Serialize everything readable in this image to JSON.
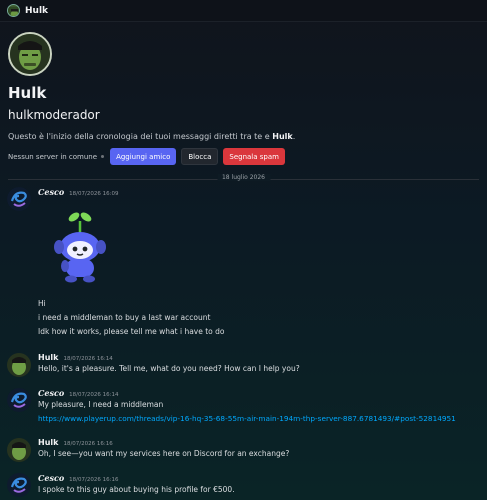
{
  "window": {
    "title": "Hulk"
  },
  "profile": {
    "display_name": "Hulk",
    "username": "hulkmoderador",
    "intro_prefix": "Questo è l'inizio della cronologia dei tuoi messaggi diretti tra te e ",
    "intro_name": "Hulk",
    "intro_suffix": ".",
    "no_server": "Nessun server in comune",
    "add_friend": "Aggiungi amico",
    "block": "Blocca",
    "report_spam": "Segnala spam"
  },
  "date_divider": "18 luglio 2026",
  "messages": [
    {
      "author": "Cesco",
      "time": "18/07/2026 16:09",
      "lines": [
        "Hi",
        "i need a middleman to buy a last war account",
        "Idk how it works, please tell me what i have to do"
      ]
    },
    {
      "author": "Hulk",
      "time": "18/07/2026 16:14",
      "lines": [
        "Hello, it's a pleasure. Tell me, what do you need? How can I help you?"
      ]
    },
    {
      "author": "Cesco",
      "time": "18/07/2026 16:14",
      "lines": [
        "My pleasure, I need a middleman"
      ],
      "link": "https://www.playerup.com/threads/vip-16-hq-35-68-55m-air-main-194m-thp-server-887.6781493/#post-52814951"
    },
    {
      "author": "Hulk",
      "time": "18/07/2026 16:16",
      "lines": [
        "Oh, I see—you want my services here on Discord for an exchange?"
      ]
    },
    {
      "author": "Cesco",
      "time": "18/07/2026 16:16",
      "lines": [
        "I spoke to this guy about buying his profile for €500."
      ]
    }
  ],
  "colors": {
    "accent": "#5865f2",
    "danger": "#da373c",
    "link": "#00a8fc"
  },
  "icons": {
    "hulk_avatar": "hulk-face-icon",
    "cesco_avatar": "swirl-avatar-icon",
    "sticker": "discord-wumpus-sprout-sticker"
  }
}
